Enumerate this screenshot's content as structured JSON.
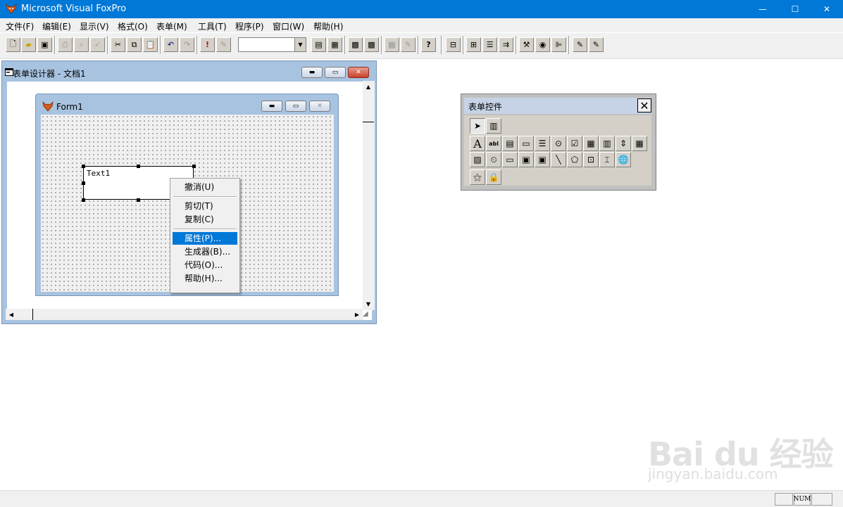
{
  "app": {
    "title": "Microsoft Visual FoxPro"
  },
  "window_buttons": {
    "minimize": "—",
    "maximize": "☐",
    "close": "✕"
  },
  "menubar": {
    "items": [
      {
        "label": "文件(F)"
      },
      {
        "label": "编辑(E)"
      },
      {
        "label": "显示(V)"
      },
      {
        "label": "格式(O)"
      },
      {
        "label": "表单(M)"
      },
      {
        "label": "工具(T)"
      },
      {
        "label": "程序(P)"
      },
      {
        "label": "窗口(W)"
      },
      {
        "label": "帮助(H)"
      }
    ]
  },
  "toolbar": {
    "combo_value": "",
    "icons": [
      "new-icon",
      "open-icon",
      "save-icon",
      "print-icon",
      "print-preview-icon",
      "spelling-icon",
      "cut-icon",
      "copy-icon",
      "paste-icon",
      "undo-icon",
      "redo-icon",
      "run-icon",
      "modify-icon",
      "combo",
      "command-window-icon",
      "view-window-icon",
      "form-wizard-icon",
      "report-wizard-icon",
      "autoform-icon",
      "autoreport-icon",
      "help-icon",
      "layout-icon",
      "data-environment-icon",
      "properties-icon",
      "code-icon",
      "toolbox-icon",
      "color-palette-icon",
      "form-controls-icon",
      "builder-icon",
      "autoformat-icon"
    ]
  },
  "designer": {
    "title": "表单设计器 - 文档1",
    "form": {
      "title": "Form1",
      "textbox_label": "Text1"
    }
  },
  "context_menu": {
    "items": [
      {
        "label": "撤消(U)",
        "selected": false
      },
      {
        "label": "剪切(T)",
        "selected": false
      },
      {
        "label": "复制(C)",
        "selected": false
      },
      {
        "label": "属性(P)...",
        "selected": true
      },
      {
        "label": "生成器(B)...",
        "selected": false
      },
      {
        "label": "代码(O)...",
        "selected": false
      },
      {
        "label": "帮助(H)...",
        "selected": false
      }
    ]
  },
  "form_controls": {
    "title": "表单控件",
    "close_glyph": "✕",
    "label_glyph": "A",
    "textbox_glyph": "abl"
  },
  "statusbar": {
    "num_indicator": "NUM"
  },
  "watermark": {
    "brand": "Bai du 经验",
    "url": "jingyan.baidu.com"
  },
  "colors": {
    "titlebar": "#0078d7",
    "selection": "#0078d7",
    "window_frame": "#a8c3e0"
  }
}
